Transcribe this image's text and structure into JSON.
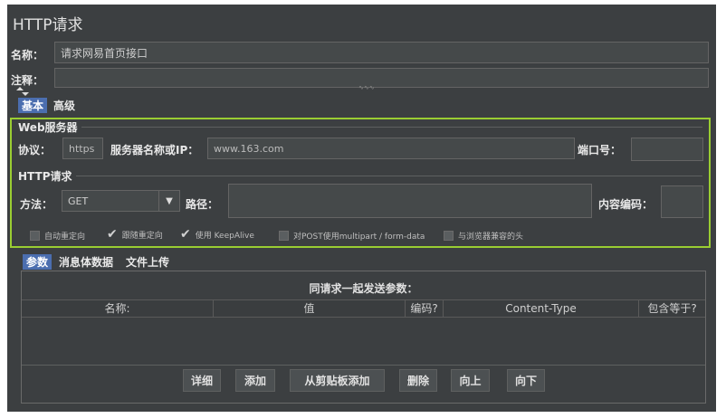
{
  "panel_title": "HTTP请求",
  "name_field": {
    "label": "名称：",
    "value": "请求网易首页接口"
  },
  "comment_field": {
    "label": "注释：",
    "value": ""
  },
  "splitter_grip": "∿∿∿",
  "top_tabs": [
    {
      "label": "基本",
      "selected": true
    },
    {
      "label": "高级",
      "selected": false
    }
  ],
  "web_server": {
    "title": "Web服务器",
    "protocol_label": "协议：",
    "protocol_value": "https",
    "server_label": "服务器名称或IP：",
    "server_value": "www.163.com",
    "port_label": "端口号：",
    "port_value": ""
  },
  "http_request": {
    "title": "HTTP请求",
    "method_label": "方法：",
    "method_value": "GET",
    "path_label": "路径：",
    "path_value": "",
    "encoding_label": "内容编码：",
    "encoding_value": ""
  },
  "options": [
    {
      "label": "自动重定向",
      "checked": false
    },
    {
      "label": "跟随重定向",
      "checked": true
    },
    {
      "label": "使用 KeepAlive",
      "checked": true
    },
    {
      "label": "对POST使用multipart / form-data",
      "checked": false
    },
    {
      "label": "与浏览器兼容的头",
      "checked": false
    }
  ],
  "param_tabs": [
    {
      "label": "参数",
      "selected": true
    },
    {
      "label": "消息体数据",
      "selected": false
    },
    {
      "label": "文件上传",
      "selected": false
    }
  ],
  "params_table": {
    "title": "同请求一起发送参数：",
    "columns": [
      "名称:",
      "值",
      "编码?",
      "Content-Type",
      "包含等于?"
    ]
  },
  "buttons": [
    "详细",
    "添加",
    "从剪贴板添加",
    "删除",
    "向上",
    "向下"
  ],
  "colors": {
    "background": "#3c3f41",
    "highlight_border": "#9acd32",
    "selected_tab": "#4b6eaf"
  }
}
